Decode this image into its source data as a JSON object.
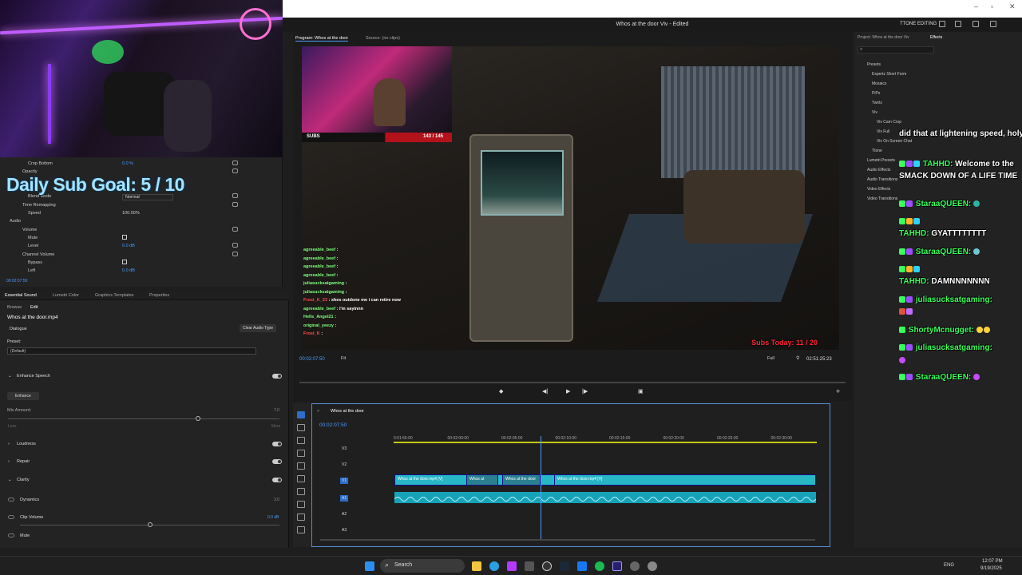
{
  "window": {
    "title": "Whos at the door Viv - Edited",
    "workspace": "TTONE EDITING"
  },
  "overlay": {
    "sub_goal": "Daily Sub Goal: 5 / 10",
    "subs_label": "SUBS",
    "subs_count": "143 / 145",
    "subs_today": "Subs Today: 11 / 20"
  },
  "effect_controls": {
    "rows": [
      {
        "label": "Crop Bottom",
        "value": "0.0 %"
      },
      {
        "label": "Opacity",
        "value": ""
      },
      {
        "label": "Blend Mode",
        "value": "Normal"
      },
      {
        "label": "Time Remapping",
        "value": ""
      },
      {
        "label": "Speed",
        "value": "100.00%"
      },
      {
        "label": "Audio",
        "value": ""
      },
      {
        "label": "Volume",
        "value": ""
      },
      {
        "label": "Mute",
        "value": ""
      },
      {
        "label": "Level",
        "value": "0.0 dB"
      },
      {
        "label": "Channel Volume",
        "value": ""
      },
      {
        "label": "Bypass",
        "value": ""
      },
      {
        "label": "Left",
        "value": "0.0 dB"
      }
    ],
    "timecode": "00:02:07:50"
  },
  "essential_sound": {
    "tabs": [
      "Essential Sound",
      "Lumetri Color",
      "Graphics Templates",
      "Properties"
    ],
    "subtabs": [
      "Browse",
      "Edit"
    ],
    "clip_name": "Whos at the door.mp4",
    "type": "Dialogue",
    "clear_button": "Clear Audio Type",
    "preset_label": "Preset:",
    "preset_value": "(Default)",
    "enhance_speech": "Enhance Speech",
    "enhance_button": "Enhance",
    "mix_amount": "Mix Amount:",
    "mix_value": "7.0",
    "mix_level": 0.7,
    "less": "Less",
    "more": "More",
    "loudness": "Loudness",
    "repair": "Repair",
    "clarity": "Clarity",
    "dynamics": "Dynamics",
    "dynamics_value": "3.0",
    "clip_volume": "Clip Volume",
    "clip_volume_value": "0.0 dB",
    "clip_volume_level": 0.5,
    "mute": "Mute"
  },
  "program": {
    "tabs": [
      "Program: Whos at the door",
      "Source: (no clips)"
    ],
    "timecode": "00:02:07:50",
    "fit": "Fit",
    "quality": "Full",
    "duration": "02:51:25:23"
  },
  "stream_chat_video": [
    {
      "name": "agreeable_beef",
      "msg": ":",
      "color": "#7dff7d"
    },
    {
      "name": "agreeable_beef",
      "msg": ":",
      "color": "#7dff7d"
    },
    {
      "name": "agreeable_beef",
      "msg": ":",
      "color": "#7dff7d"
    },
    {
      "name": "agreeable_beef",
      "msg": ":",
      "color": "#7dff7d"
    },
    {
      "name": "juliasucksatgaming",
      "msg": ":",
      "color": "#7dff7d"
    },
    {
      "name": "juliasucksatgaming",
      "msg": ":",
      "color": "#7dff7d"
    },
    {
      "name": "Frost_K_23",
      "msg": ": shes outdone me i can retire now",
      "color": "#ff4d4d"
    },
    {
      "name": "agreeable_beef",
      "msg": ": i'm sayinnn",
      "color": "#7dff7d"
    },
    {
      "name": "Hells_Angel21",
      "msg": ":",
      "color": "#7dff7d"
    },
    {
      "name": "original_yeezy",
      "msg": ":",
      "color": "#7dff7d"
    },
    {
      "name": "Frost_K",
      "msg": ":",
      "color": "#ff4d4d"
    }
  ],
  "timeline": {
    "sequence": "Whos at the door",
    "timecode": "00:02:07:50",
    "ticks": [
      "0:01:55:00",
      "00:02:00:00",
      "00:02:05:00",
      "00:02:10:00",
      "00:02:15:00",
      "00:02:20:00",
      "00:02:25:00",
      "00:02:30:00"
    ],
    "tracks": [
      "V3",
      "V2",
      "V1",
      "A1",
      "A2",
      "A3"
    ],
    "clips": [
      {
        "label": "Whos at the door.mp4 [V]"
      },
      {
        "label": "Whos at"
      },
      {
        "label": "Whos at the door"
      },
      {
        "label": "Whos at the door.mp4 [V]"
      }
    ]
  },
  "project_panel": {
    "tabs": [
      "Project: Whos at the door Viv",
      "Effects"
    ],
    "tree": [
      "Presets",
      "Expertz Short Form",
      "Mosaics",
      "PiPs",
      "Twirls",
      "Viv",
      "Viv Cam Crop",
      "Viv Full",
      "Viv On Screen Chat",
      "Ttone",
      "Lumetri Presets",
      "Audio Effects",
      "Audio Transitions",
      "Video Effects",
      "Video Transitions"
    ]
  },
  "stream_chat": [
    {
      "name": "",
      "msg": "did that at lightening speed, holy fuck."
    },
    {
      "name": "TAHHD:",
      "msg": "Welcome to the SMACK DOWN OF A LIFE TIME"
    },
    {
      "name": "StaraaQUEEN:",
      "msg": ""
    },
    {
      "name": "TAHHD:",
      "msg": "GYATTTTTTTT"
    },
    {
      "name": "StaraaQUEEN:",
      "msg": ""
    },
    {
      "name": "TAHHD:",
      "msg": "DAMNNNNNNN"
    },
    {
      "name": "juliasucksatgaming:",
      "msg": ""
    },
    {
      "name": "ShortyMcnugget:",
      "msg": ""
    },
    {
      "name": "juliasucksatgaming:",
      "msg": ""
    },
    {
      "name": "StaraaQUEEN:",
      "msg": ""
    }
  ],
  "taskbar": {
    "search": "Search",
    "lang": "ENG",
    "time": "12:07 PM",
    "date": "9/19/2025"
  }
}
